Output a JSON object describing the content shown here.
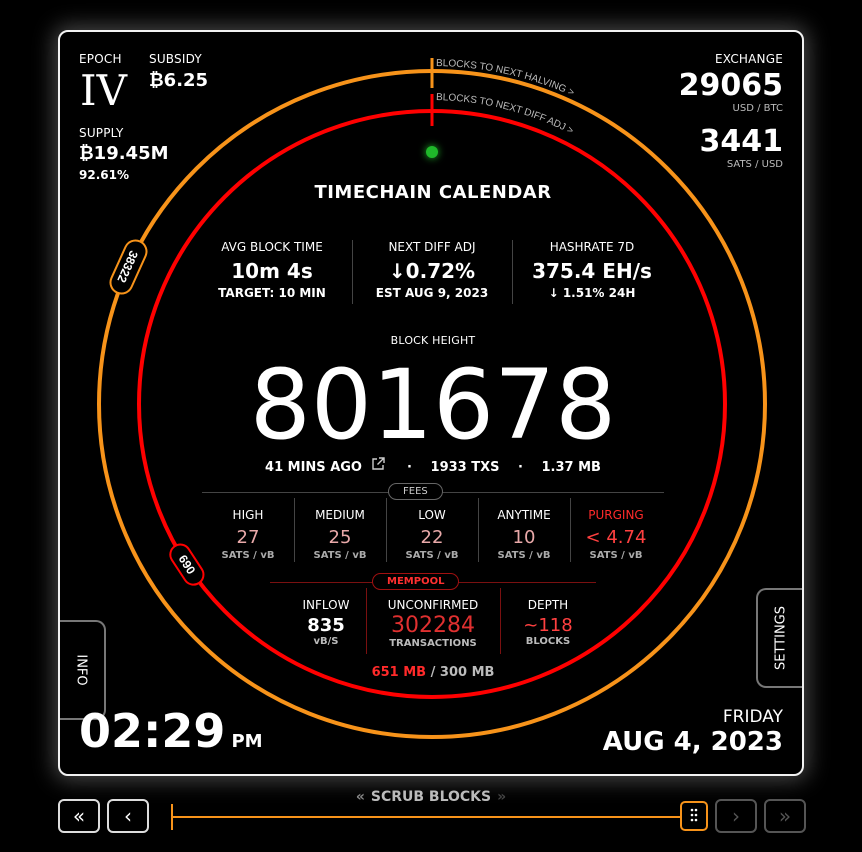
{
  "epoch": {
    "label": "EPOCH",
    "value": "IV"
  },
  "subsidy": {
    "label": "SUBSIDY",
    "value": "₿6.25"
  },
  "supply": {
    "label": "SUPPLY",
    "value": "₿19.45M",
    "percent": "92.61%"
  },
  "exchange": {
    "label": "EXCHANGE",
    "usd_btc": "29065",
    "usd_btc_unit": "USD / BTC",
    "sats_usd": "3441",
    "sats_usd_unit": "SATS / USD"
  },
  "rings": {
    "halving_label": "BLOCKS TO NEXT HALVING >",
    "diff_label": "BLOCKS TO NEXT DIFF ADJ >",
    "halving_marker": "38322",
    "diff_marker": "690",
    "halving_color": "#f7931a",
    "diff_color": "#ff0000",
    "halving_progress": 0.8175,
    "diff_progress": 0.6577
  },
  "title": "TIMECHAIN CALENDAR",
  "stats": [
    {
      "label": "AVG BLOCK TIME",
      "value": "10m 4s",
      "sub": "TARGET: 10 MIN"
    },
    {
      "label": "NEXT DIFF ADJ",
      "value": "↓0.72%",
      "sub": "EST AUG 9, 2023"
    },
    {
      "label": "HASHRATE 7D",
      "value": "375.4 EH/s",
      "sub": "↓ 1.51% 24H"
    }
  ],
  "block": {
    "label": "BLOCK HEIGHT",
    "height": "801678",
    "ago": "41 MINS AGO",
    "txs": "1933 TXS",
    "size": "1.37 MB",
    "sep": "·"
  },
  "fees": {
    "label": "FEES",
    "unit": "SATS / vB",
    "items": [
      {
        "label": "HIGH",
        "value": "27"
      },
      {
        "label": "MEDIUM",
        "value": "25"
      },
      {
        "label": "LOW",
        "value": "22"
      },
      {
        "label": "ANYTIME",
        "value": "10"
      },
      {
        "label": "PURGING",
        "value": "< 4.74"
      }
    ]
  },
  "mempool": {
    "label": "MEMPOOL",
    "inflow_label": "INFLOW",
    "inflow_value": "835",
    "inflow_unit": "vB/S",
    "unconfirmed_label": "UNCONFIRMED",
    "unconfirmed_value": "302284",
    "unconfirmed_unit": "TRANSACTIONS",
    "depth_label": "DEPTH",
    "depth_value": "~118",
    "depth_unit": "BLOCKS",
    "usage": "651 MB",
    "usage_sep": " / ",
    "max": "300 MB"
  },
  "buttons": {
    "info": "INFO",
    "settings": "SETTINGS"
  },
  "time": {
    "value": "02:29",
    "ampm": "PM"
  },
  "date": {
    "weekday": "FRIDAY",
    "date": "AUG 4, 2023"
  },
  "scrub": {
    "label": "SCRUB BLOCKS",
    "left_arrows": "«",
    "right_arrows": "»",
    "first": "«",
    "prev": "‹",
    "next": "›",
    "last": "»",
    "position": 1.0
  },
  "status_dot_color": "#1fb82a"
}
